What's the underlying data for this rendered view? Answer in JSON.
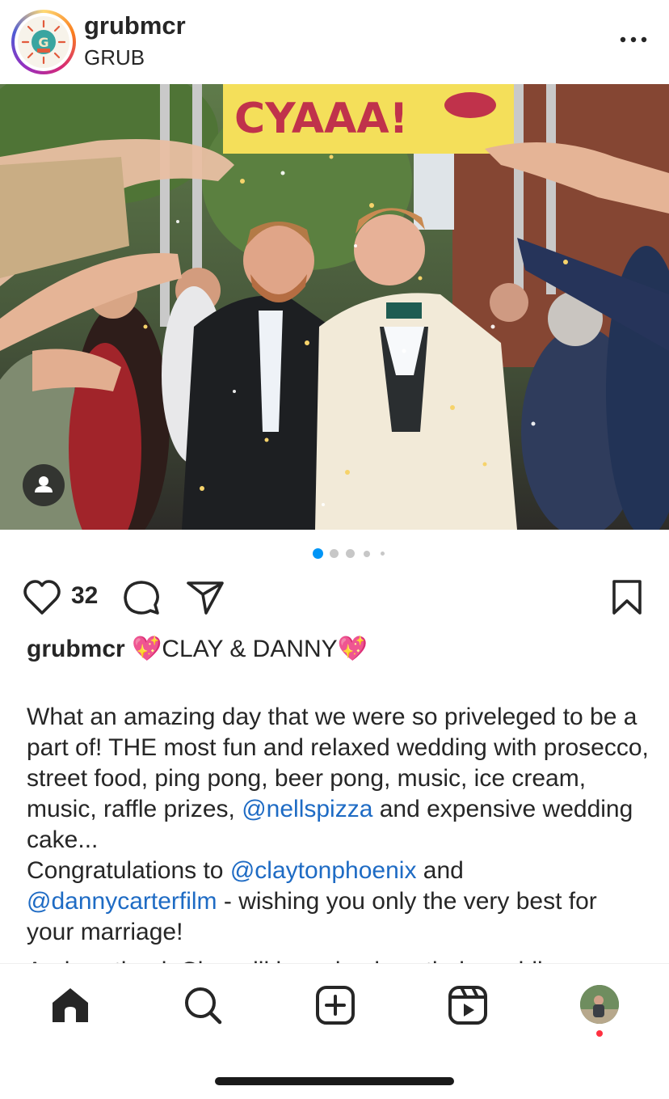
{
  "header": {
    "username": "grubmcr",
    "subtitle": "GRUB",
    "avatar_icon": "grub-logo",
    "more_icon": "more-options-icon"
  },
  "post": {
    "banner_text": "CYAAA!",
    "carousel": {
      "total": 5,
      "active": 1
    },
    "likes": "32",
    "accent_color": "#0095f6",
    "caption": {
      "username": "grubmcr",
      "headline_emoji_1": "💖",
      "headline_text": "CLAY & DANNY",
      "headline_emoji_2": "💖",
      "p1_text": "What an amazing day that we were so priveleged to be a part of! THE most fun and relaxed wedding with prosecco, street food, ping pong, beer pong, music, ice cream, music, raffle prizes,",
      "p1_link": "@nellspizza",
      "p1_after": "and expensive wedding cake...",
      "p2_before": "Congratulations to",
      "p2_link1": "@claytonphoenix",
      "p2_mid": "and",
      "p2_link2": "@dannycarterfilm",
      "p2_after": "- wishing you only the very best for your marriage!",
      "cutoff_text": "And we thank Clay will be using how their wedding"
    }
  },
  "nav": {
    "items": [
      "home-icon",
      "search-icon",
      "create-icon",
      "reels-icon",
      "profile-avatar"
    ],
    "notification_color": "#ff3040"
  }
}
